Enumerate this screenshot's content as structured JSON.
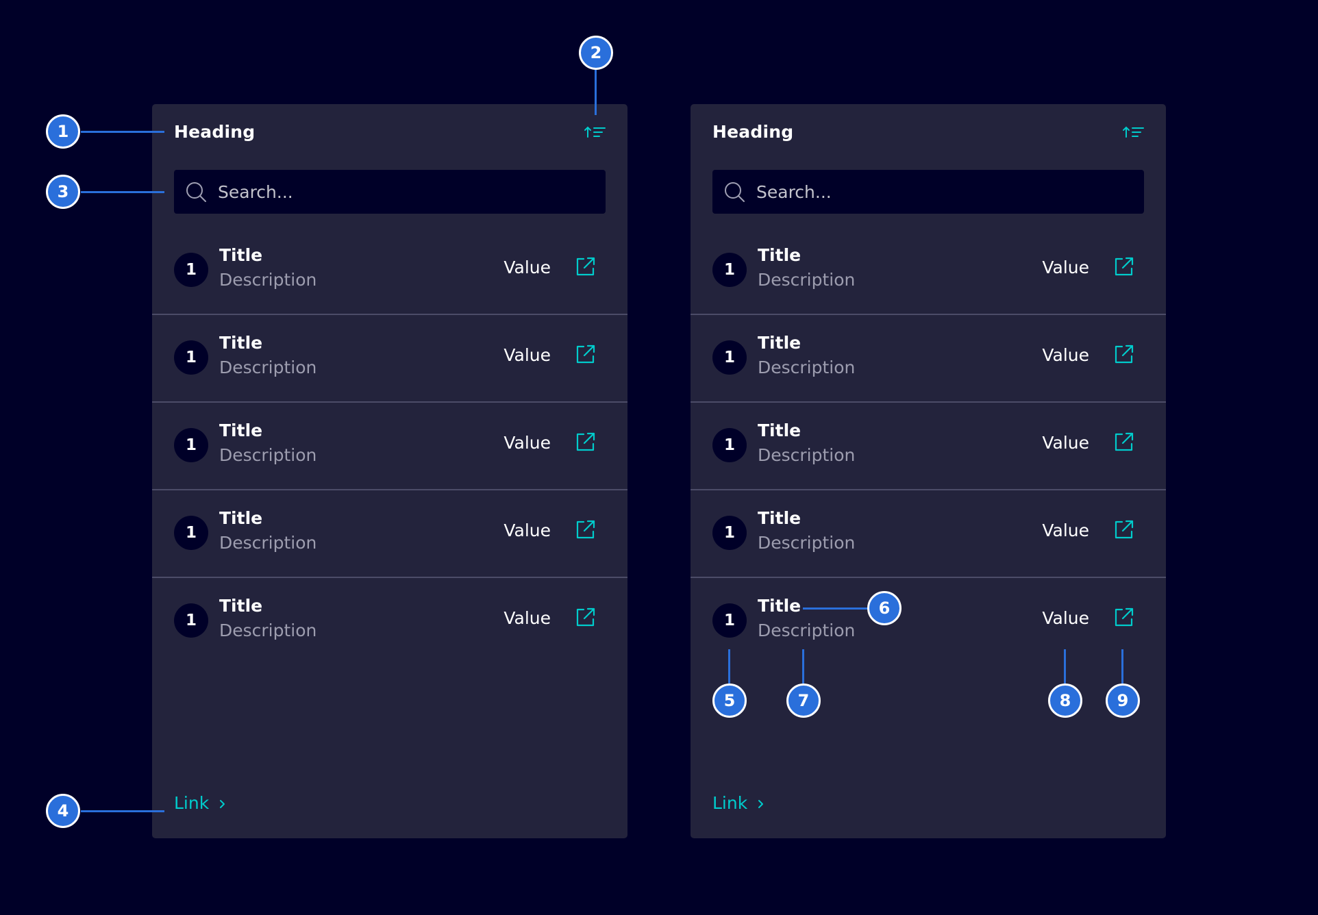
{
  "widgets": [
    {
      "heading": "Heading",
      "search_placeholder": "Search...",
      "link_label": "Link",
      "items": [
        {
          "badge": "1",
          "title": "Title",
          "description": "Description",
          "value": "Value"
        },
        {
          "badge": "1",
          "title": "Title",
          "description": "Description",
          "value": "Value"
        },
        {
          "badge": "1",
          "title": "Title",
          "description": "Description",
          "value": "Value"
        },
        {
          "badge": "1",
          "title": "Title",
          "description": "Description",
          "value": "Value"
        },
        {
          "badge": "1",
          "title": "Title",
          "description": "Description",
          "value": "Value"
        }
      ]
    },
    {
      "heading": "Heading",
      "search_placeholder": "Search...",
      "link_label": "Link",
      "items": [
        {
          "badge": "1",
          "title": "Title",
          "description": "Description",
          "value": "Value"
        },
        {
          "badge": "1",
          "title": "Title",
          "description": "Description",
          "value": "Value"
        },
        {
          "badge": "1",
          "title": "Title",
          "description": "Description",
          "value": "Value"
        },
        {
          "badge": "1",
          "title": "Title",
          "description": "Description",
          "value": "Value"
        },
        {
          "badge": "1",
          "title": "Title",
          "description": "Description",
          "value": "Value"
        }
      ]
    }
  ],
  "annotations": {
    "heading": "1",
    "sort": "2",
    "search": "3",
    "link": "4",
    "badge": "5",
    "title": "6",
    "description": "7",
    "value": "8",
    "action": "9"
  },
  "icons": {
    "sort": "sort-ascending-icon",
    "search": "search-icon",
    "row_action": "external-link-icon",
    "link": "chevron-right-icon"
  },
  "colors": {
    "background": "#000028",
    "card": "#23233c",
    "accent": "#00cccc",
    "annotation": "#2a6fdb",
    "divider": "#4c4c68",
    "description": "#9d9daf"
  }
}
